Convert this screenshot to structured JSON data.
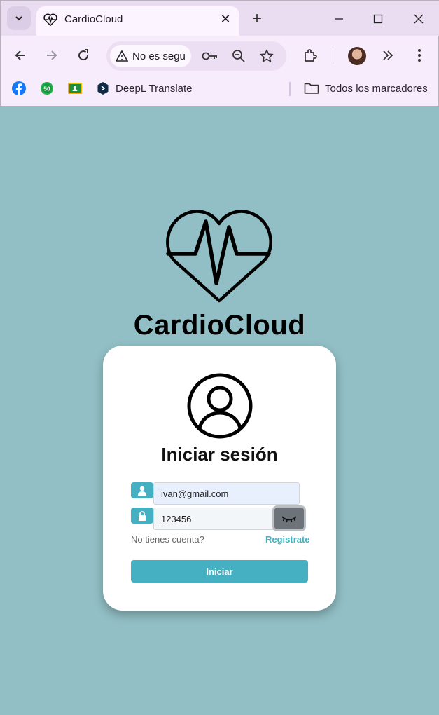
{
  "browser": {
    "tab_title": "CardioCloud",
    "security_chip": "No es segu",
    "bookmarks": [
      {
        "label": "",
        "icon": "facebook-icon",
        "color": "#1877f2"
      },
      {
        "label": "",
        "icon": "badge-50-icon",
        "badge_text": "50",
        "color": "#22b14c"
      },
      {
        "label": "",
        "icon": "google-classroom-icon",
        "color": "#f4b400"
      },
      {
        "label": "DeepL Translate",
        "icon": "deepl-icon",
        "color": "#0f2b46"
      }
    ],
    "all_bookmarks_label": "Todos los marcadores"
  },
  "brand": {
    "name": "CardioCloud",
    "logo": "heart-pulse-icon"
  },
  "login": {
    "title": "Iniciar sesión",
    "email_value": "ivan@gmail.com",
    "password_value": "123456",
    "no_account_text": "No tienes cuenta?",
    "register_link": "Registrate",
    "submit_label": "Iniciar"
  },
  "colors": {
    "page_background": "#91bfc5",
    "accent": "#44b0c1",
    "card": "#ffffff",
    "eye_button": "#6d7378"
  }
}
